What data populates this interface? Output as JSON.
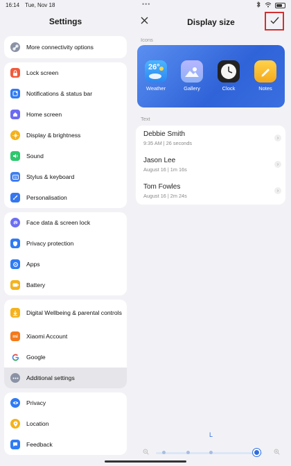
{
  "status": {
    "time": "16:14",
    "date": "Tue, Nov 18",
    "dots": "•••",
    "battery": "battery-icon"
  },
  "left": {
    "title": "Settings",
    "groups": [
      {
        "items": [
          {
            "label": "More connectivity options",
            "icon": "link-icon",
            "color": "#8a93a6"
          }
        ]
      },
      {
        "items": [
          {
            "label": "Lock screen",
            "icon": "lock-icon",
            "color": "#f15a3b"
          },
          {
            "label": "Notifications & status bar",
            "icon": "notification-icon",
            "color": "#2f7bf5"
          },
          {
            "label": "Home screen",
            "icon": "home-icon",
            "color": "#6d6bf2"
          },
          {
            "label": "Display & brightness",
            "icon": "sun-icon",
            "color": "#f5b21b"
          },
          {
            "label": "Sound",
            "icon": "sound-icon",
            "color": "#2ec76d"
          },
          {
            "label": "Stylus & keyboard",
            "icon": "keyboard-icon",
            "color": "#3e7df1"
          },
          {
            "label": "Personalisation",
            "icon": "brush-icon",
            "color": "#3477f0"
          }
        ]
      },
      {
        "items": [
          {
            "label": "Face data & screen lock",
            "icon": "fingerprint-icon",
            "color": "#6b6ef2"
          },
          {
            "label": "Privacy protection",
            "icon": "shield-icon",
            "color": "#2f7bf5"
          },
          {
            "label": "Apps",
            "icon": "apps-icon",
            "color": "#2f7bf5"
          },
          {
            "label": "Battery",
            "icon": "battery-icon",
            "color": "#f5b21b"
          }
        ]
      },
      {
        "items": [
          {
            "label": "Digital Wellbeing & parental controls",
            "icon": "wellbeing-icon",
            "color": "#f5b21b"
          },
          {
            "label": "Xiaomi Account",
            "icon": "xiaomi-icon",
            "color": "#f57a1b"
          },
          {
            "label": "Google",
            "icon": "google-icon",
            "color": "#ffffff"
          },
          {
            "label": "Additional settings",
            "icon": "more-icon",
            "color": "#8a93a6",
            "selected": true
          }
        ]
      },
      {
        "items": [
          {
            "label": "Privacy",
            "icon": "eye-icon",
            "color": "#2f7bf5"
          },
          {
            "label": "Location",
            "icon": "location-icon",
            "color": "#f5b21b"
          },
          {
            "label": "Feedback",
            "icon": "feedback-icon",
            "color": "#2f7bf5"
          }
        ]
      }
    ]
  },
  "right": {
    "title": "Display size",
    "close_icon": "close-icon",
    "confirm_icon": "check-icon",
    "icons_label": "Icons",
    "apps": [
      {
        "name": "Weather",
        "tile_text": "26°",
        "color": "#3aa1ff"
      },
      {
        "name": "Gallery",
        "tile_text": "",
        "color": "#a2a9f7"
      },
      {
        "name": "Clock",
        "tile_text": "",
        "color": "#222222"
      },
      {
        "name": "Notes",
        "tile_text": "",
        "color": "#f7c23a"
      }
    ],
    "text_label": "Text",
    "contacts": [
      {
        "name": "Debbie Smith",
        "meta": "9:35 AM | 26 seconds"
      },
      {
        "name": "Jason Lee",
        "meta": "August 16 | 1m 16s"
      },
      {
        "name": "Tom Fowles",
        "meta": "August 16 | 2m 24s"
      }
    ],
    "size_letter": "L",
    "slider": {
      "steps": 5,
      "selected_step": 4
    }
  }
}
